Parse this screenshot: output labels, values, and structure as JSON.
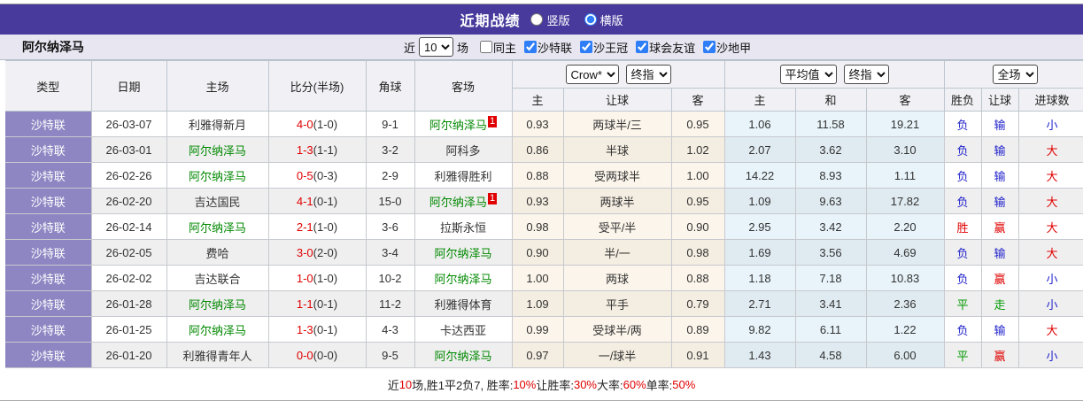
{
  "titlebar": {
    "title": "近期战绩",
    "layout_options": [
      {
        "label": "竖版",
        "selected": false
      },
      {
        "label": "横版",
        "selected": true
      }
    ]
  },
  "team_bar": {
    "team": "阿尔纳泽马",
    "near_label": "近",
    "near_value": "10",
    "games_label": "场",
    "filters": [
      {
        "label": "同主",
        "checked": false
      },
      {
        "label": "沙特联",
        "checked": true
      },
      {
        "label": "沙王冠",
        "checked": true
      },
      {
        "label": "球会友谊",
        "checked": true
      },
      {
        "label": "沙地甲",
        "checked": true
      }
    ]
  },
  "table": {
    "headers": {
      "main": [
        "类型",
        "日期",
        "主场",
        "比分(半场)",
        "角球",
        "客场"
      ],
      "sub": [
        "主",
        "让球",
        "客",
        "主",
        "和",
        "客",
        "胜负",
        "让球",
        "进球数"
      ],
      "controls": {
        "odds_provider": "Crow*",
        "odds_type": "终指",
        "avg_label": "平均值",
        "avg_type": "终指",
        "scope": "全场"
      }
    },
    "rows": [
      {
        "league": "沙特联",
        "date": "26-03-07",
        "home": "利雅得新月",
        "home_green": false,
        "home_badge": "",
        "score_ft": "4-0",
        "score_ht": "(1-0)",
        "corners": "9-1",
        "away": "阿尔纳泽马",
        "away_green": true,
        "away_badge": "1",
        "odds_home": "0.93",
        "handicap": "两球半/三",
        "odds_away": "0.95",
        "avg_home": "1.06",
        "avg_draw": "11.58",
        "avg_away": "19.21",
        "result": "负",
        "result_color": "blue",
        "handicap_result": "输",
        "handicap_result_color": "blue",
        "goals": "小",
        "goals_color": "blue"
      },
      {
        "league": "沙特联",
        "date": "26-03-01",
        "home": "阿尔纳泽马",
        "home_green": true,
        "home_badge": "",
        "score_ft": "1-3",
        "score_ht": "(1-1)",
        "corners": "3-2",
        "away": "阿科多",
        "away_green": false,
        "away_badge": "",
        "odds_home": "0.86",
        "handicap": "半球",
        "odds_away": "1.02",
        "avg_home": "2.07",
        "avg_draw": "3.62",
        "avg_away": "3.10",
        "result": "负",
        "result_color": "blue",
        "handicap_result": "输",
        "handicap_result_color": "blue",
        "goals": "大",
        "goals_color": "red"
      },
      {
        "league": "沙特联",
        "date": "26-02-26",
        "home": "阿尔纳泽马",
        "home_green": true,
        "home_badge": "",
        "score_ft": "0-5",
        "score_ht": "(0-3)",
        "corners": "2-9",
        "away": "利雅得胜利",
        "away_green": false,
        "away_badge": "",
        "odds_home": "0.88",
        "handicap": "受两球半",
        "odds_away": "1.00",
        "avg_home": "14.22",
        "avg_draw": "8.93",
        "avg_away": "1.11",
        "result": "负",
        "result_color": "blue",
        "handicap_result": "输",
        "handicap_result_color": "blue",
        "goals": "大",
        "goals_color": "red"
      },
      {
        "league": "沙特联",
        "date": "26-02-20",
        "home": "吉达国民",
        "home_green": false,
        "home_badge": "",
        "score_ft": "4-1",
        "score_ht": "(0-1)",
        "corners": "15-0",
        "away": "阿尔纳泽马",
        "away_green": true,
        "away_badge": "1",
        "odds_home": "0.93",
        "handicap": "两球半",
        "odds_away": "0.95",
        "avg_home": "1.09",
        "avg_draw": "9.63",
        "avg_away": "17.82",
        "result": "负",
        "result_color": "blue",
        "handicap_result": "输",
        "handicap_result_color": "blue",
        "goals": "大",
        "goals_color": "red"
      },
      {
        "league": "沙特联",
        "date": "26-02-14",
        "home": "阿尔纳泽马",
        "home_green": true,
        "home_badge": "",
        "score_ft": "2-1",
        "score_ht": "(1-0)",
        "corners": "3-6",
        "away": "拉斯永恒",
        "away_green": false,
        "away_badge": "",
        "odds_home": "0.98",
        "handicap": "受平/半",
        "odds_away": "0.90",
        "avg_home": "2.95",
        "avg_draw": "3.42",
        "avg_away": "2.20",
        "result": "胜",
        "result_color": "red",
        "handicap_result": "赢",
        "handicap_result_color": "red",
        "goals": "大",
        "goals_color": "red"
      },
      {
        "league": "沙特联",
        "date": "26-02-05",
        "home": "费哈",
        "home_green": false,
        "home_badge": "",
        "score_ft": "3-0",
        "score_ht": "(2-0)",
        "corners": "3-4",
        "away": "阿尔纳泽马",
        "away_green": true,
        "away_badge": "",
        "odds_home": "0.90",
        "handicap": "半/一",
        "odds_away": "0.98",
        "avg_home": "1.69",
        "avg_draw": "3.56",
        "avg_away": "4.69",
        "result": "负",
        "result_color": "blue",
        "handicap_result": "输",
        "handicap_result_color": "blue",
        "goals": "大",
        "goals_color": "red"
      },
      {
        "league": "沙特联",
        "date": "26-02-02",
        "home": "吉达联合",
        "home_green": false,
        "home_badge": "",
        "score_ft": "1-0",
        "score_ht": "(1-0)",
        "corners": "10-2",
        "away": "阿尔纳泽马",
        "away_green": true,
        "away_badge": "",
        "odds_home": "1.00",
        "handicap": "两球",
        "odds_away": "0.88",
        "avg_home": "1.18",
        "avg_draw": "7.18",
        "avg_away": "10.83",
        "result": "负",
        "result_color": "blue",
        "handicap_result": "赢",
        "handicap_result_color": "red",
        "goals": "小",
        "goals_color": "blue"
      },
      {
        "league": "沙特联",
        "date": "26-01-28",
        "home": "阿尔纳泽马",
        "home_green": true,
        "home_badge": "",
        "score_ft": "1-1",
        "score_ht": "(0-1)",
        "corners": "11-2",
        "away": "利雅得体育",
        "away_green": false,
        "away_badge": "",
        "odds_home": "1.09",
        "handicap": "平手",
        "odds_away": "0.79",
        "avg_home": "2.71",
        "avg_draw": "3.41",
        "avg_away": "2.36",
        "result": "平",
        "result_color": "green",
        "handicap_result": "走",
        "handicap_result_color": "green",
        "goals": "小",
        "goals_color": "blue"
      },
      {
        "league": "沙特联",
        "date": "26-01-25",
        "home": "阿尔纳泽马",
        "home_green": true,
        "home_badge": "",
        "score_ft": "1-3",
        "score_ht": "(0-1)",
        "corners": "4-3",
        "away": "卡达西亚",
        "away_green": false,
        "away_badge": "",
        "odds_home": "0.99",
        "handicap": "受球半/两",
        "odds_away": "0.89",
        "avg_home": "9.82",
        "avg_draw": "6.11",
        "avg_away": "1.22",
        "result": "负",
        "result_color": "blue",
        "handicap_result": "输",
        "handicap_result_color": "blue",
        "goals": "大",
        "goals_color": "red"
      },
      {
        "league": "沙特联",
        "date": "26-01-20",
        "home": "利雅得青年人",
        "home_green": false,
        "home_badge": "",
        "score_ft": "0-0",
        "score_ht": "(0-0)",
        "corners": "9-5",
        "away": "阿尔纳泽马",
        "away_green": true,
        "away_badge": "",
        "odds_home": "0.97",
        "handicap": "一/球半",
        "odds_away": "0.91",
        "avg_home": "1.43",
        "avg_draw": "4.58",
        "avg_away": "6.00",
        "result": "平",
        "result_color": "green",
        "handicap_result": "赢",
        "handicap_result_color": "red",
        "goals": "小",
        "goals_color": "blue"
      }
    ]
  },
  "summary": {
    "segments": [
      {
        "text": "近",
        "red": false
      },
      {
        "text": "10",
        "red": true
      },
      {
        "text": "场,胜1平2负7, 胜率:",
        "red": false
      },
      {
        "text": "10%",
        "red": true
      },
      {
        "text": " 让胜率:",
        "red": false
      },
      {
        "text": "30%",
        "red": true
      },
      {
        "text": " 大率:",
        "red": false
      },
      {
        "text": "60%",
        "red": true
      },
      {
        "text": " 单率:",
        "red": false
      },
      {
        "text": "50%",
        "red": true
      }
    ]
  },
  "colors": {
    "accent_purple": "#483a9d",
    "league_cell_purple": "#8d86c3",
    "win_red": "#e00000",
    "loss_blue": "#2222cc",
    "draw_green": "#009900",
    "team_green": "#008800"
  }
}
